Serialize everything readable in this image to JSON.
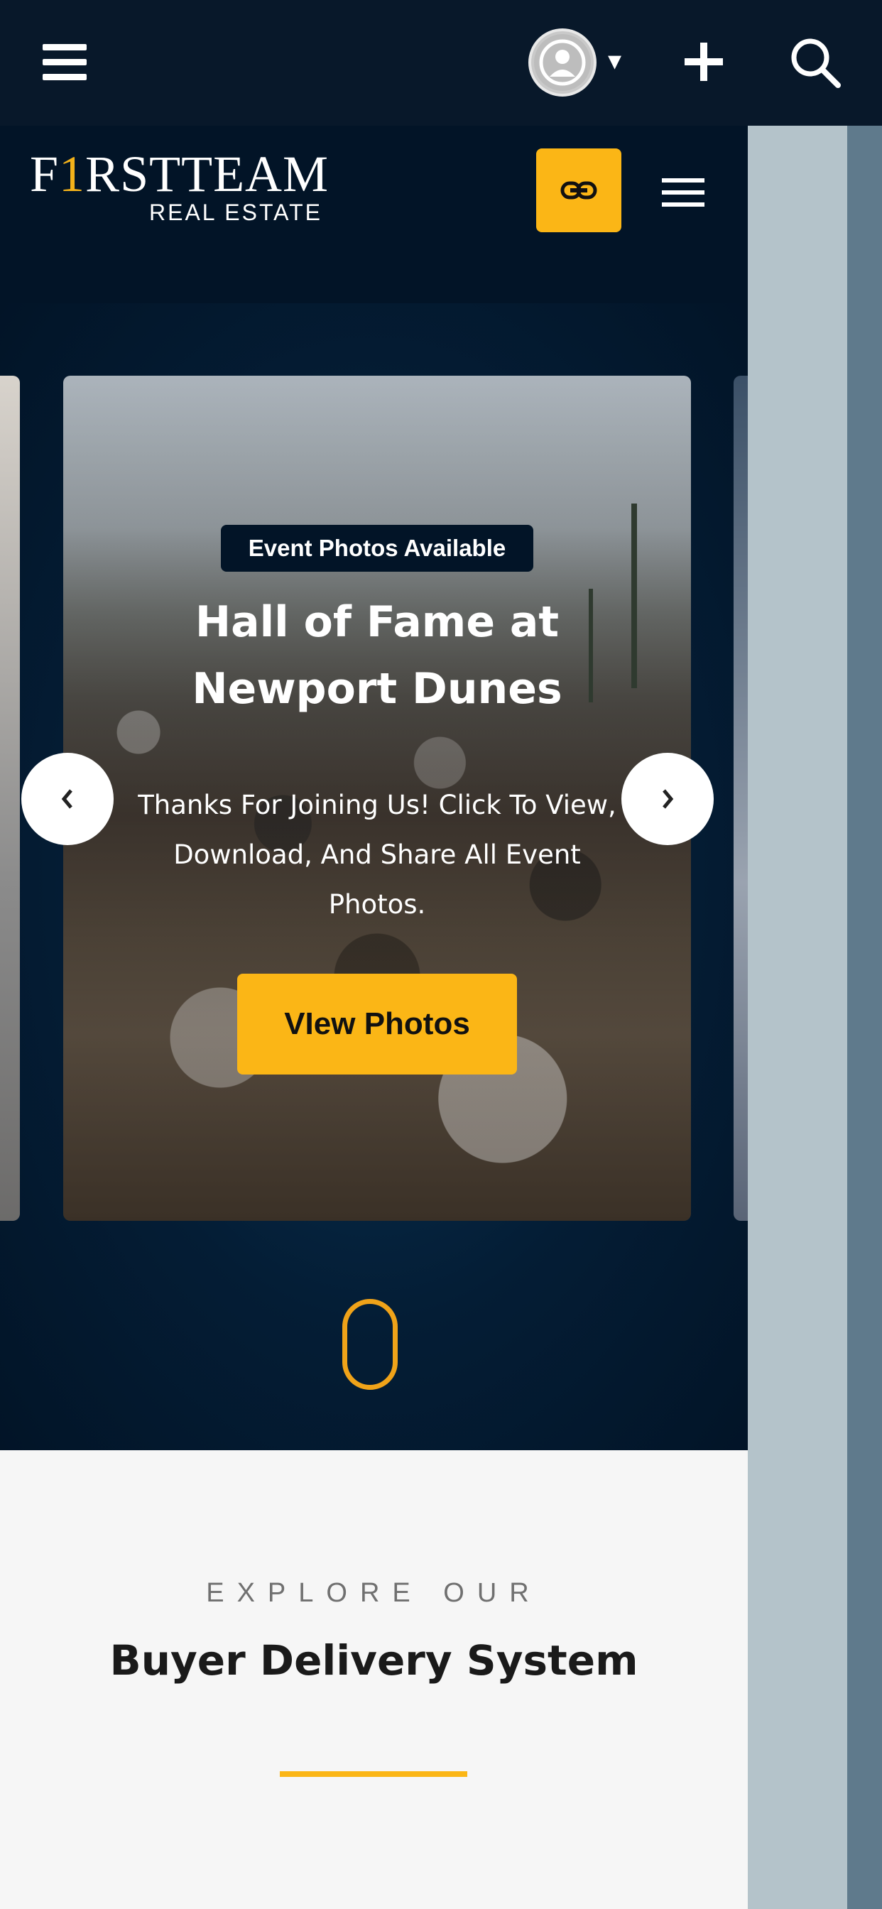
{
  "appbar": {
    "menu_icon": "hamburger-icon",
    "avatar_icon": "user-avatar-icon",
    "avatar_caret": "▾",
    "add_icon": "plus-icon",
    "search_icon": "search-icon"
  },
  "site": {
    "logo_first": "F",
    "logo_one": "1",
    "logo_rest": "RSTTEAM",
    "logo_sub": "REAL ESTATE",
    "link_icon": "link-icon",
    "menu_icon": "hamburger-icon"
  },
  "slide": {
    "badge": "Event Photos Available",
    "title": "Hall of Fame at Newport Dunes",
    "description": "Thanks For Joining Us! Click To View, Download, And Share All Event Photos.",
    "button": "VIew Photos",
    "prev_icon": "‹",
    "next_icon": "›"
  },
  "explore": {
    "kicker": "EXPLORE OUR",
    "title": "Buyer Delivery System"
  },
  "colors": {
    "accent": "#fbb616",
    "navy": "#021427",
    "appbar": "#08182a"
  }
}
